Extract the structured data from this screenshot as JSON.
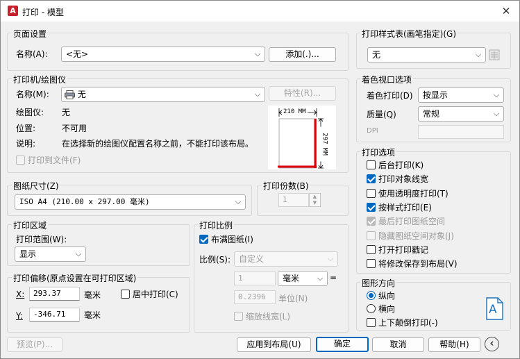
{
  "window": {
    "title": "打印 - 模型",
    "close_glyph": "✕",
    "app_icon_letter": "A"
  },
  "page_setup": {
    "group_title": "页面设置",
    "name_label": "名称(A):",
    "name_value": "<无>",
    "add_button": "添加(.)..."
  },
  "printer": {
    "group_title": "打印机/绘图仪",
    "name_label": "名称(M):",
    "name_value": "无",
    "properties_button": "特性(R)...",
    "plotter_label": "绘图仪:",
    "plotter_value": "无",
    "location_label": "位置:",
    "location_value": "不可用",
    "description_label": "说明:",
    "description_value": "在选择新的绘图仪配置名称之前，不能打印该布局。",
    "print_to_file": "打印到文件(F)",
    "preview_width": "210 MM",
    "preview_height": "297 MM"
  },
  "paper_size": {
    "group_title": "图纸尺寸(Z)",
    "value": "ISO A4 (210.00 x 297.00 毫米)"
  },
  "copies": {
    "group_title": "打印份数(B)",
    "value": "1"
  },
  "plot_area": {
    "group_title": "打印区域",
    "range_label": "打印范围(W):",
    "range_value": "显示"
  },
  "plot_offset": {
    "group_title": "打印偏移(原点设置在可打印区域)",
    "x_label": "X:",
    "x_value": "293.37",
    "x_unit": "毫米",
    "y_label": "Y:",
    "y_value": "-346.71",
    "y_unit": "毫米",
    "center_plot": "居中打印(C)"
  },
  "plot_scale": {
    "group_title": "打印比例",
    "fit_to_paper": "布满图纸(I)",
    "scale_label": "比例(S):",
    "scale_value": "自定义",
    "value_1": "1",
    "unit_value": "毫米",
    "equals": "=",
    "value_2": "0.2396",
    "unit_label": "单位(N)",
    "scale_lineweights": "缩放线宽(L)"
  },
  "plot_style_table": {
    "group_title": "打印样式表(画笔指定)(G)",
    "value": "无"
  },
  "shaded_viewport": {
    "group_title": "着色视口选项",
    "shade_plot_label": "着色打印(D)",
    "shade_plot_value": "按显示",
    "quality_label": "质量(Q)",
    "quality_value": "常规",
    "dpi_label": "DPI"
  },
  "plot_options": {
    "group_title": "打印选项",
    "items": [
      {
        "label": "后台打印(K)",
        "checked": false,
        "disabled": false
      },
      {
        "label": "打印对象线宽",
        "checked": true,
        "disabled": false
      },
      {
        "label": "使用透明度打印(T)",
        "checked": false,
        "disabled": false
      },
      {
        "label": "按样式打印(E)",
        "checked": true,
        "disabled": false
      },
      {
        "label": "最后打印图纸空间",
        "checked": true,
        "disabled": true
      },
      {
        "label": "隐藏图纸空间对象(J)",
        "checked": false,
        "disabled": true
      },
      {
        "label": "打开打印戳记",
        "checked": false,
        "disabled": false
      },
      {
        "label": "将修改保存到布局(V)",
        "checked": false,
        "disabled": false
      }
    ]
  },
  "drawing_orientation": {
    "group_title": "图形方向",
    "portrait": "纵向",
    "landscape": "横向",
    "upside_down": "上下颠倒打印(-)",
    "icon_letter": "A"
  },
  "footer": {
    "preview": "预览(P)...",
    "apply_to_layout": "应用到布局(U)",
    "ok": "确定",
    "cancel": "取消",
    "help": "帮助(H)",
    "more_glyph": "‹"
  },
  "colors": {
    "accent": "#0067c0",
    "preview_red": "#e00000",
    "app_icon": "#c8202a"
  }
}
